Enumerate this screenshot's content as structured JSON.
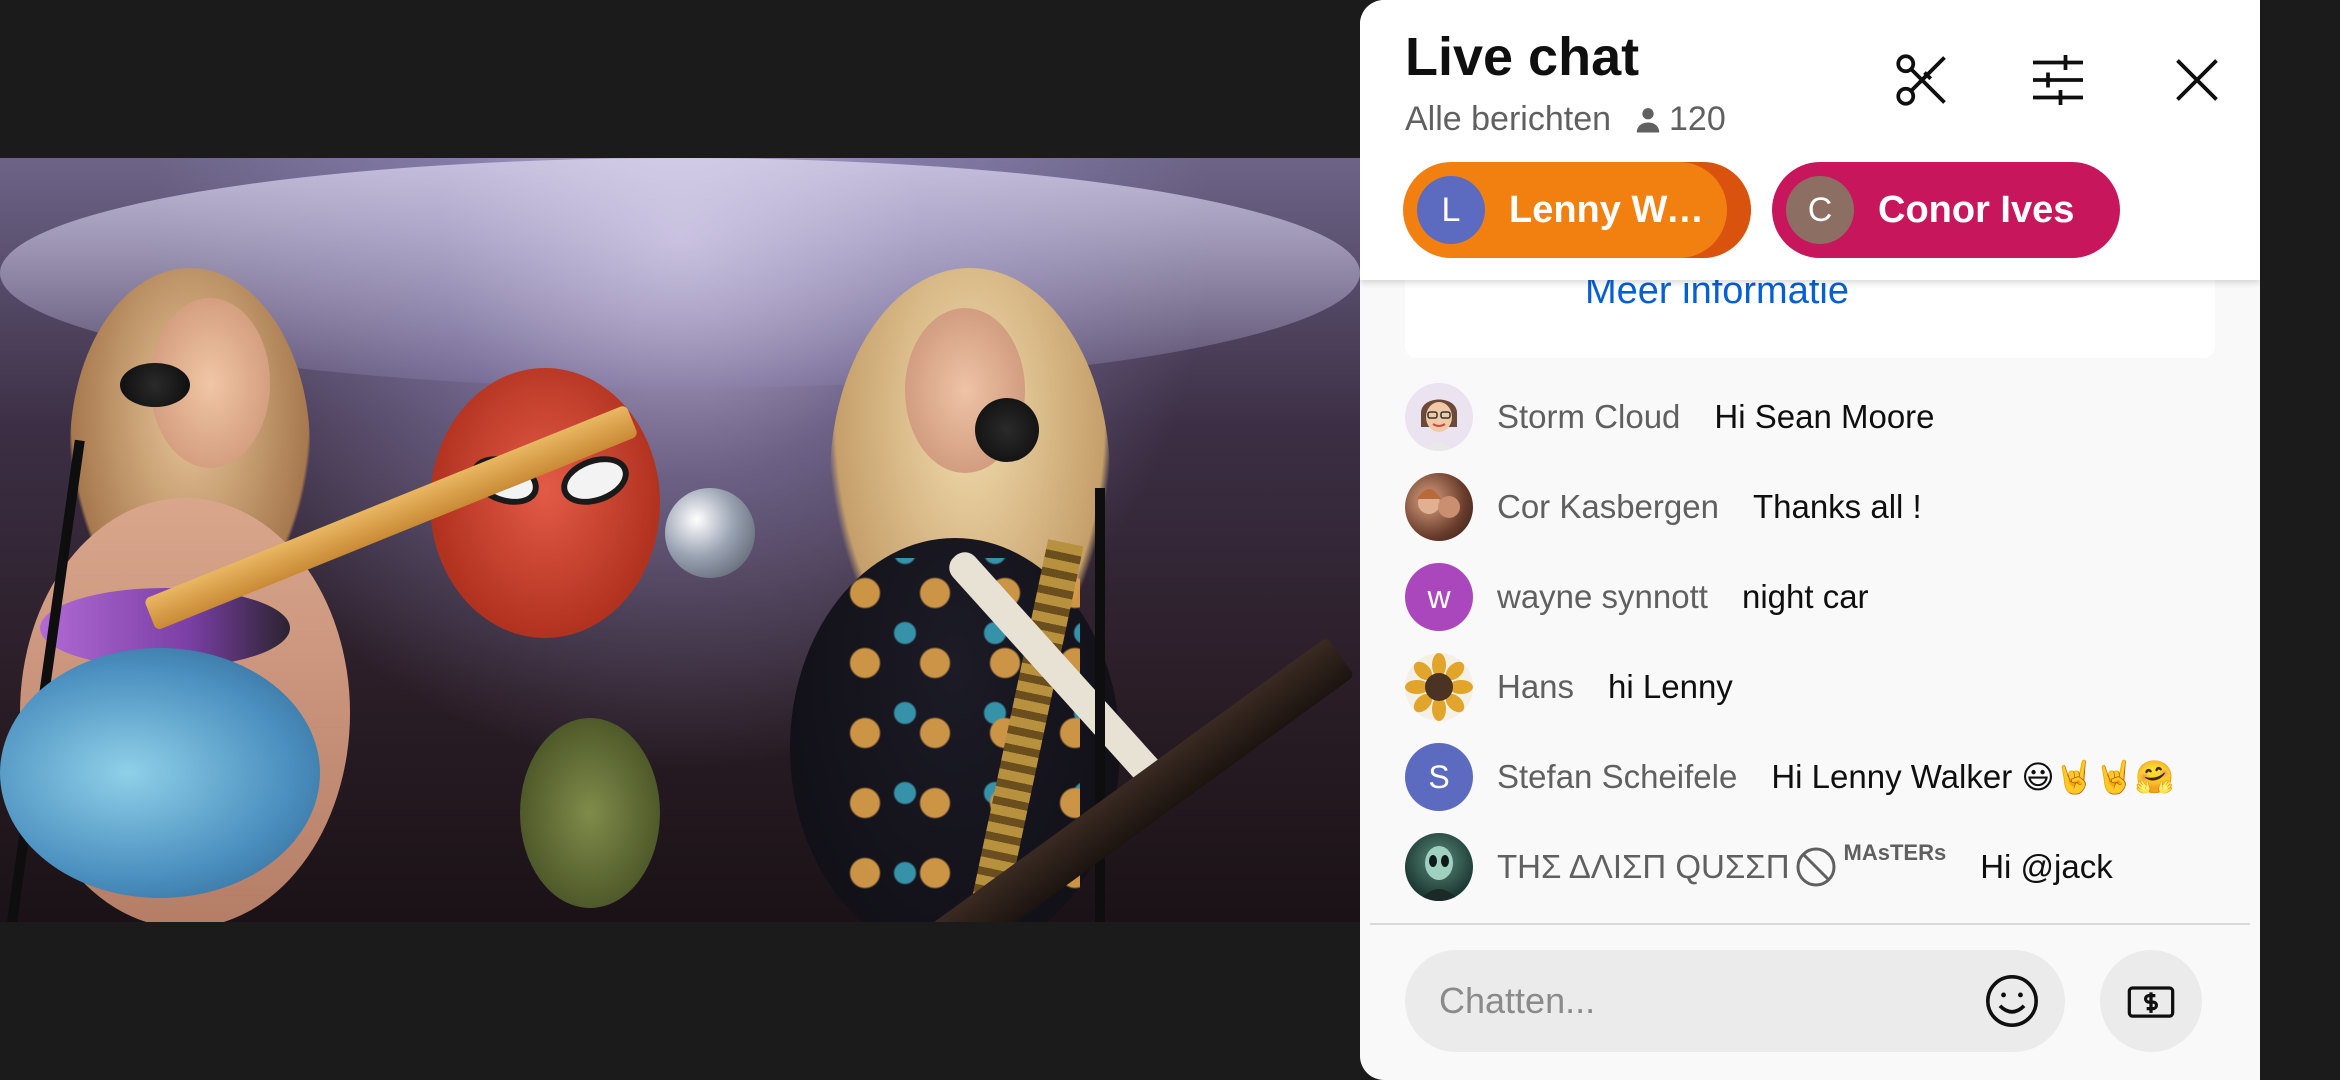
{
  "chat": {
    "title": "Live chat",
    "mode": "Alle berichten",
    "viewer_count": "120"
  },
  "header_icons": [
    "clip-icon",
    "filter-icon",
    "close-icon"
  ],
  "pinned_chips": [
    {
      "initial": "L",
      "name": "Lenny Wal...",
      "color": "#f28011"
    },
    {
      "initial": "C",
      "name": "Conor Ives",
      "color": "#c8165d"
    }
  ],
  "pinned_card": {
    "link": "Meer informatie"
  },
  "messages": [
    {
      "author": "Storm Cloud",
      "text": "Hi Sean Moore",
      "avatar": "memoji"
    },
    {
      "author": "Cor Kasbergen",
      "text": "Thanks all !",
      "avatar": "photo"
    },
    {
      "author": "wayne synnott",
      "text": "night car",
      "avatar_initial": "w",
      "avatar_color": "#ab47bc"
    },
    {
      "author": "Hans",
      "text": "hi Lenny",
      "avatar": "sunflower"
    },
    {
      "author": "Stefan Scheifele",
      "text": "Hi Lenny Walker",
      "emoji": "😃🤘🤘🤗",
      "avatar_initial": "S",
      "avatar_color": "#5c6bc0"
    },
    {
      "author": "ΤΗΣ ΔΛΙΣΠ QUΣΣΠ",
      "author_badge": "MAsTERs",
      "text": "Hi @jack",
      "avatar": "alien"
    }
  ],
  "input": {
    "placeholder": "Chatten..."
  },
  "colors": {
    "accent_link": "#065fd4",
    "panel_bg": "#f9f9f9"
  }
}
